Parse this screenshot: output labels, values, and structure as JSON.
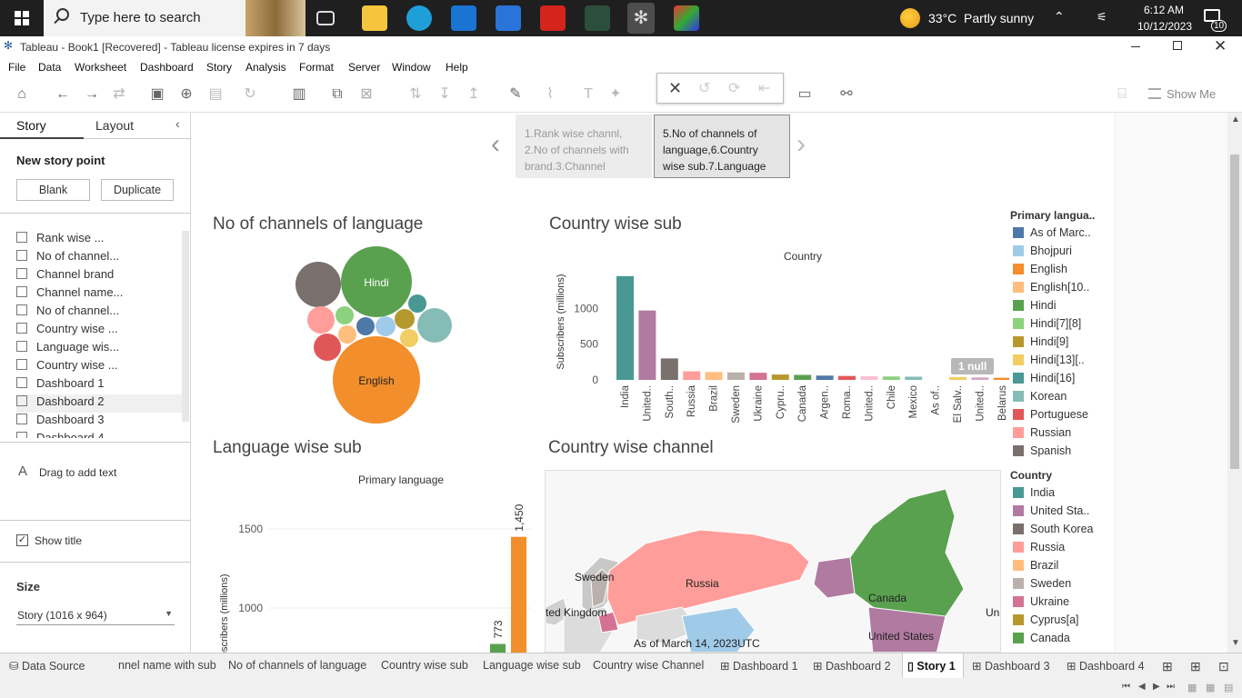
{
  "taskbar": {
    "search_placeholder": "Type here to search",
    "weather": "33°C  Partly sunny",
    "time": "6:12 AM",
    "date": "10/12/2023",
    "notif_count": "10"
  },
  "window": {
    "title": "Tableau - Book1 [Recovered] - Tableau license expires in 7 days"
  },
  "menu": [
    "File",
    "Data",
    "Worksheet",
    "Dashboard",
    "Story",
    "Analysis",
    "Format",
    "Server",
    "Window",
    "Help"
  ],
  "toolbar": {
    "show_me": "Show Me"
  },
  "left_panel": {
    "tab_story": "Story",
    "tab_layout": "Layout",
    "new_story_point": "New story point",
    "blank_button": "Blank",
    "duplicate_button": "Duplicate",
    "sheets": [
      "Rank wise ...",
      "No of channel...",
      "Channel brand",
      "Channel name...",
      "No of channel...",
      "Country wise ...",
      "Language wis...",
      "Country wise ...",
      "Dashboard 1",
      "Dashboard 2",
      "Dashboard 3",
      "Dashboard 4"
    ],
    "drag_text": "Drag to add text",
    "show_title": "Show title",
    "size_label": "Size",
    "size_value": "Story (1016 x 964)"
  },
  "story_nav": {
    "point1": "1.Rank wise channl, 2.No of channels with brand.3.Channel",
    "point2": "5.No of channels of language,6.Country wise sub.7.Language"
  },
  "charts": {
    "bubble_title": "No of channels of language",
    "country_sub_title": "Country wise sub",
    "country_sub_header": "Country",
    "country_sub_ylabel": "Subscribers (millions)",
    "null_badge": "1 null",
    "lang_sub_title": "Language wise sub",
    "lang_sub_header": "Primary language",
    "lang_sub_ylabel": "Subscribers (millions)",
    "country_channel_title": "Country wise channel"
  },
  "chart_data": [
    {
      "type": "scatter",
      "subtype": "packed-bubble",
      "title": "No of channels of language",
      "bubbles": [
        {
          "label": "Hindi",
          "color": "#59a14f"
        },
        {
          "label": "English",
          "color": "#f28e2b"
        },
        {
          "label": "",
          "color": "#79706e"
        },
        {
          "label": "",
          "color": "#ff9d9a"
        },
        {
          "label": "",
          "color": "#e15759"
        },
        {
          "label": "",
          "color": "#8cd17d"
        },
        {
          "label": "",
          "color": "#4e79a7"
        },
        {
          "label": "",
          "color": "#a0cbe8"
        },
        {
          "label": "",
          "color": "#ffbe7d"
        },
        {
          "label": "",
          "color": "#b6992d"
        },
        {
          "label": "",
          "color": "#f1ce63"
        },
        {
          "label": "",
          "color": "#499894"
        },
        {
          "label": "",
          "color": "#86bcb6"
        }
      ]
    },
    {
      "type": "bar",
      "title": "Country wise sub",
      "xlabel": "Country",
      "ylabel": "Subscribers (millions)",
      "ylim": [
        0,
        1600
      ],
      "yticks": [
        0,
        500,
        1000
      ],
      "categories": [
        "India",
        "United..",
        "South..",
        "Russia",
        "Brazil",
        "Sweden",
        "Ukraine",
        "Cypru..",
        "Canada",
        "Argen..",
        "Roma..",
        "United..",
        "Chile",
        "Mexico",
        "As of..",
        "El Salv..",
        "United..",
        "Belarus"
      ],
      "values": [
        1450,
        970,
        300,
        120,
        110,
        105,
        100,
        75,
        70,
        60,
        55,
        50,
        48,
        45,
        0,
        40,
        35,
        30
      ],
      "colors": [
        "#499894",
        "#b07aa1",
        "#79706e",
        "#ff9d9a",
        "#ffbe7d",
        "#bab0ac",
        "#d37295",
        "#b6992d",
        "#59a14f",
        "#4e79a7",
        "#e15759",
        "#fabfd2",
        "#8cd17d",
        "#86bcb6",
        "#ffffff",
        "#f1ce63",
        "#d4a6c8",
        "#f28e2b"
      ]
    },
    {
      "type": "bar",
      "title": "Language wise sub",
      "xlabel": "Primary language",
      "ylabel": "Subscribers (millions)",
      "yticks": [
        1000,
        1500
      ],
      "categories": [
        "Hindi",
        "English"
      ],
      "values": [
        773,
        1450
      ],
      "colors": [
        "#59a14f",
        "#f28e2b"
      ]
    },
    {
      "type": "map",
      "title": "Country wise channel",
      "labels": [
        "Sweden",
        "Russia",
        "ted Kingdom",
        "Canada",
        "United States",
        "As of March 14, 2023UTC",
        "Uni"
      ]
    }
  ],
  "legend_language": {
    "title": "Primary langua..",
    "items": [
      {
        "label": "As of Marc..",
        "color": "#4e79a7"
      },
      {
        "label": "Bhojpuri",
        "color": "#a0cbe8"
      },
      {
        "label": "English",
        "color": "#f28e2b"
      },
      {
        "label": "English[10..",
        "color": "#ffbe7d"
      },
      {
        "label": "Hindi",
        "color": "#59a14f"
      },
      {
        "label": "Hindi[7][8]",
        "color": "#8cd17d"
      },
      {
        "label": "Hindi[9]",
        "color": "#b6992d"
      },
      {
        "label": "Hindi[13][..",
        "color": "#f1ce63"
      },
      {
        "label": "Hindi[16]",
        "color": "#499894"
      },
      {
        "label": "Korean",
        "color": "#86bcb6"
      },
      {
        "label": "Portuguese",
        "color": "#e15759"
      },
      {
        "label": "Russian",
        "color": "#ff9d9a"
      },
      {
        "label": "Spanish",
        "color": "#79706e"
      }
    ]
  },
  "legend_country": {
    "title": "Country",
    "items": [
      {
        "label": "India",
        "color": "#499894"
      },
      {
        "label": "United Sta..",
        "color": "#b07aa1"
      },
      {
        "label": "South Korea",
        "color": "#79706e"
      },
      {
        "label": "Russia",
        "color": "#ff9d9a"
      },
      {
        "label": "Brazil",
        "color": "#ffbe7d"
      },
      {
        "label": "Sweden",
        "color": "#bab0ac"
      },
      {
        "label": "Ukraine",
        "color": "#d37295"
      },
      {
        "label": "Cyprus[a]",
        "color": "#b6992d"
      },
      {
        "label": "Canada",
        "color": "#59a14f"
      }
    ]
  },
  "bottom_tabs": [
    "Data Source",
    "nnel name with sub",
    "No of channels of language",
    "Country wise sub",
    "Language wise sub",
    "Country wise Channel",
    "Dashboard 1",
    "Dashboard 2",
    "Story 1",
    "Dashboard 3",
    "Dashboard 4"
  ]
}
